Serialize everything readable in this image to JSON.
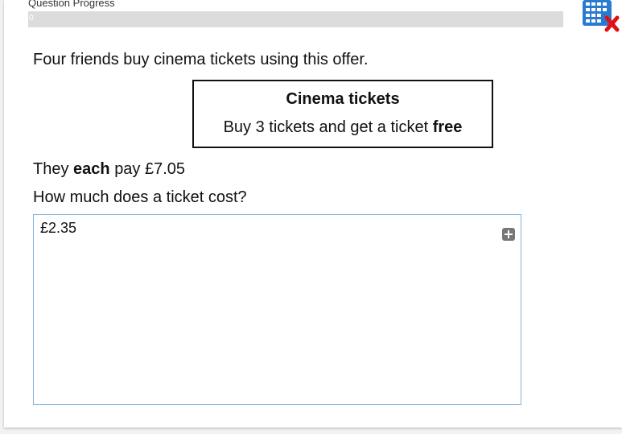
{
  "progress": {
    "label": "Question Progress",
    "value_text": "0",
    "fraction": 0,
    "fill_color": "#a9c9e8"
  },
  "tools": {
    "calculator_icon": "calculator-disabled-icon",
    "calculator_color": "#2a7bd0",
    "cross_color": "#e0101a"
  },
  "question": {
    "intro": "Four friends buy cinema tickets using this offer.",
    "offer_title": "Cinema tickets",
    "offer_text": "Buy 3 tickets and get a ticket",
    "offer_emphasis": "free",
    "pay_prefix": "They",
    "pay_emphasis": "each",
    "pay_suffix": "pay £7.05",
    "prompt": "How much does a ticket cost?"
  },
  "answer": {
    "value": "£2.35",
    "expand_icon": "plus-icon"
  }
}
